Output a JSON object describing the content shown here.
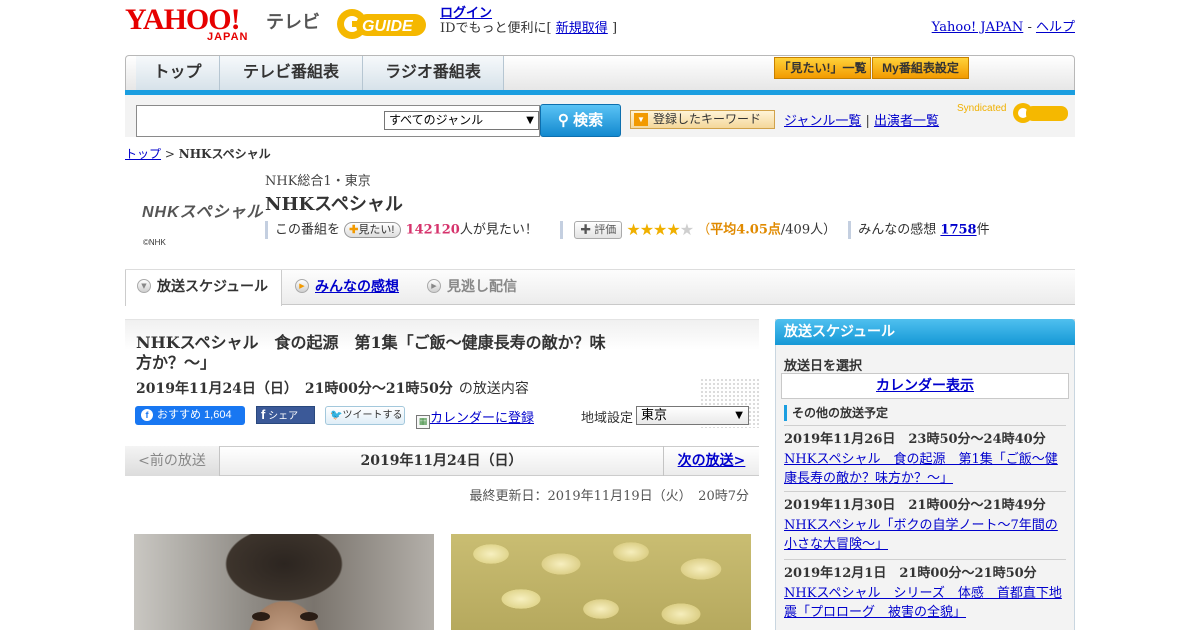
{
  "header": {
    "yahoo_logo": "YAHOO!",
    "japan_logo": "JAPAN",
    "tv_label": "テレビ",
    "gguide_logo": "GUIDE",
    "login": "ログイン",
    "login_prefix": "IDでもっと便利に[",
    "signup": "新規取得",
    "login_suffix": "]",
    "yahoo_japan_link": "Yahoo! JAPAN",
    "sep": "-",
    "help_link": "ヘルプ"
  },
  "nav": {
    "tabs": [
      {
        "label": "トップ"
      },
      {
        "label": "テレビ番組表"
      },
      {
        "label": "ラジオ番組表"
      }
    ],
    "mitai_list": "「見たい!」一覧",
    "my_schedule": "My番組表設定"
  },
  "search": {
    "genre_selected": "すべてのジャンル",
    "search_button": "検索",
    "keyword_button": "登録したキーワード",
    "genre_list": "ジャンル一覧",
    "divider": "|",
    "performer_list": "出演者一覧",
    "syndicated": "Syndicated"
  },
  "breadcrumb": {
    "top": "トップ",
    "sep": ">",
    "current": "NHKスペシャル"
  },
  "program": {
    "logo_text": "NHKスペシャル",
    "copyright": "©NHK",
    "channel": "NHK総合1・東京",
    "title": "NHKスペシャル",
    "want_prefix": "この番組を",
    "want_button": "見たい!",
    "want_count": "142120",
    "want_suffix": "人が見たい！",
    "eval_button": "評価",
    "rating_stars": 4,
    "rating_open": "（",
    "rating_avg": "平均4.05点",
    "rating_people": "/409人）",
    "impressions_prefix": "みんなの感想",
    "impressions_count": "1758",
    "impressions_suffix": "件"
  },
  "subtabs": [
    {
      "label": "放送スケジュール"
    },
    {
      "label": "みんなの感想"
    },
    {
      "label": "見逃し配信"
    }
  ],
  "episode": {
    "title": "NHKスペシャル　食の起源　第1集「ご飯～健康長寿の敵か？味方か？～」",
    "date": "2019年11月24日（日）　21時00分～21時50分",
    "date_suffix": "の放送内容",
    "fb_label": "おすすめ 1,604",
    "share_label": "シェア",
    "tweet_label": "ツイートする",
    "calendar_link": "カレンダーに登録",
    "region_label": "地域設定",
    "region_selected": "東京",
    "prev": "<前の放送",
    "current_date": "2019年11月24日（日）",
    "next": "次の放送>",
    "updated": "最終更新日：2019年11月19日（火）　20時7分"
  },
  "sidebar": {
    "header": "放送スケジュール",
    "select_date": "放送日を選択",
    "calendar": "カレンダー表示",
    "other_schedule": "その他の放送予定",
    "items": [
      {
        "when": "2019年11月26日　23時50分～24時40分",
        "what": "NHKスペシャル　食の起源　第1集「ご飯～健康長寿の敵か？味方か？～」"
      },
      {
        "when": "2019年11月30日　21時00分～21時49分",
        "what": "NHKスペシャル「ボクの自学ノート～7年間の小さな大冒険～」"
      },
      {
        "when": "2019年12月1日　21時00分～21時50分",
        "what": "NHKスペシャル　シリーズ　体感　首都直下地震「プロローグ　被害の全貌」"
      }
    ]
  },
  "colors": {
    "accent_blue": "#1b9ee0",
    "link": "#0000cc",
    "brand_red": "#e60000",
    "star": "#f0b000"
  }
}
